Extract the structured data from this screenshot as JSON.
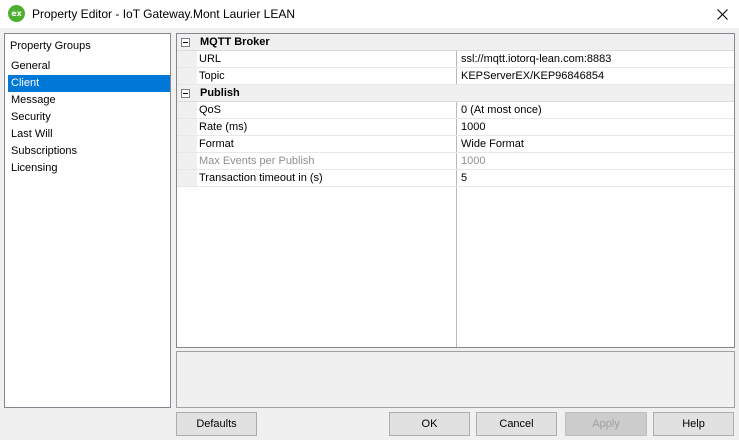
{
  "window": {
    "icon_text": "ex",
    "title": "Property Editor - IoT Gateway.Mont Laurier LEAN"
  },
  "left_panel": {
    "header": "Property Groups",
    "items": [
      {
        "label": "General",
        "selected": false
      },
      {
        "label": "Client",
        "selected": true
      },
      {
        "label": "Message",
        "selected": false
      },
      {
        "label": "Security",
        "selected": false
      },
      {
        "label": "Last Will",
        "selected": false
      },
      {
        "label": "Subscriptions",
        "selected": false
      },
      {
        "label": "Licensing",
        "selected": false
      }
    ]
  },
  "grid": {
    "categories": [
      {
        "label": "MQTT Broker",
        "properties": [
          {
            "name": "URL",
            "value": "ssl://mqtt.iotorq-lean.com:8883",
            "disabled": false
          },
          {
            "name": "Topic",
            "value": "KEPServerEX/KEP96846854",
            "disabled": false
          }
        ]
      },
      {
        "label": "Publish",
        "properties": [
          {
            "name": "QoS",
            "value": "0 (At most once)",
            "disabled": false
          },
          {
            "name": "Rate (ms)",
            "value": "1000",
            "disabled": false
          },
          {
            "name": "Format",
            "value": "Wide Format",
            "disabled": false
          },
          {
            "name": "Max Events per Publish",
            "value": "1000",
            "disabled": true
          },
          {
            "name": "Transaction timeout in (s)",
            "value": "5",
            "disabled": false
          }
        ]
      }
    ]
  },
  "buttons": {
    "defaults": "Defaults",
    "ok": "OK",
    "cancel": "Cancel",
    "apply": "Apply",
    "help": "Help"
  },
  "colors": {
    "selection": "#0078d7",
    "app_icon": "#4caf2f"
  }
}
